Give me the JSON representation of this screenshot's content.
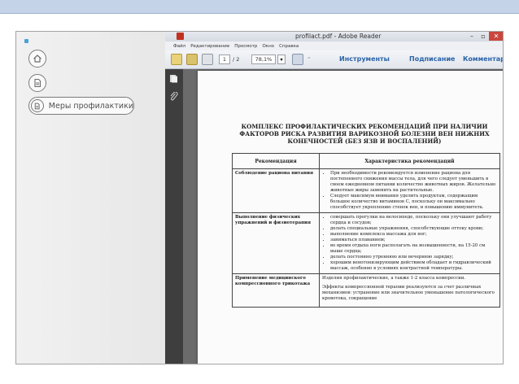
{
  "left_panel": {
    "items": [
      {
        "icon": "home-icon"
      },
      {
        "icon": "document-icon"
      },
      {
        "icon": "document-icon",
        "label": "Меры профилактики"
      }
    ]
  },
  "reader": {
    "title": "profilact.pdf - Adobe Reader",
    "menu": [
      "Файл",
      "Редактирование",
      "Просмотр",
      "Окно",
      "Справка"
    ],
    "page_current": "1",
    "page_total": "/ 2",
    "zoom": "78,1%",
    "toolbar_links": [
      "Инструменты",
      "Подписание",
      "Комментарии"
    ],
    "window_controls": [
      "–",
      "▫",
      "✕"
    ]
  },
  "document": {
    "title_lines": [
      "КОМПЛЕКС ПРОФИЛАКТИЧЕСКИХ РЕКОМЕНДАЦИЙ ПРИ НАЛИЧИИ",
      "ФАКТОРОВ РИСКА РАЗВИТИЯ ВАРИКОЗНОЙ БОЛЕЗНИ ВЕН НИЖНИХ",
      "КОНЕЧНОСТЕЙ (БЕЗ ЯЗВ И ВОСПАЛЕНИЙ)"
    ],
    "table": {
      "headers": [
        "Рекомендация",
        "Характеристика рекомендаций"
      ],
      "rows": [
        {
          "recommendation": "Соблюдение рациона питания",
          "items": [
            "При необходимости рекомендуется изменение рациона для постепенного снижения массы тела, для чего следует уменьшить в своем ежедневном питании количество животных жиров. Желательно животные жиры заменить на растительные.",
            "Следует максимум внимания уделить продуктам, содержащим большое количество витаминов С, поскольку он максимально способствует укреплению стенок вен, и повышению иммунитета."
          ]
        },
        {
          "recommendation": "Выполнение физических упражнений и физиотерапия",
          "items": [
            "совершать прогулки на велосипеде, поскольку они улучшают работу сердца и сосудов;",
            "делать специальные упражнения, способствующие оттоку крови;",
            "выполнение комплекса массажа для ног;",
            "заниматься плаванием;",
            "во время отдыха ноги располагать на возвышенности, на 15-20 см выше сердца;",
            "делать постоянно утреннюю или вечернюю зарядку;",
            "хорошим венотонизирующим действием обладает и гидравлический массаж, особенно в условиях контрастной температуры."
          ]
        },
        {
          "recommendation": "Применение медицинского компрессионного трикотажа",
          "paragraphs": [
            "Изделия профилактические, а также 1-2 класса компрессии.",
            "Эффекты компрессионной терапии реализуются за счет различных механизмов: устранение или значительное уменьшение патологического кровотока, сокращение"
          ]
        }
      ]
    }
  }
}
